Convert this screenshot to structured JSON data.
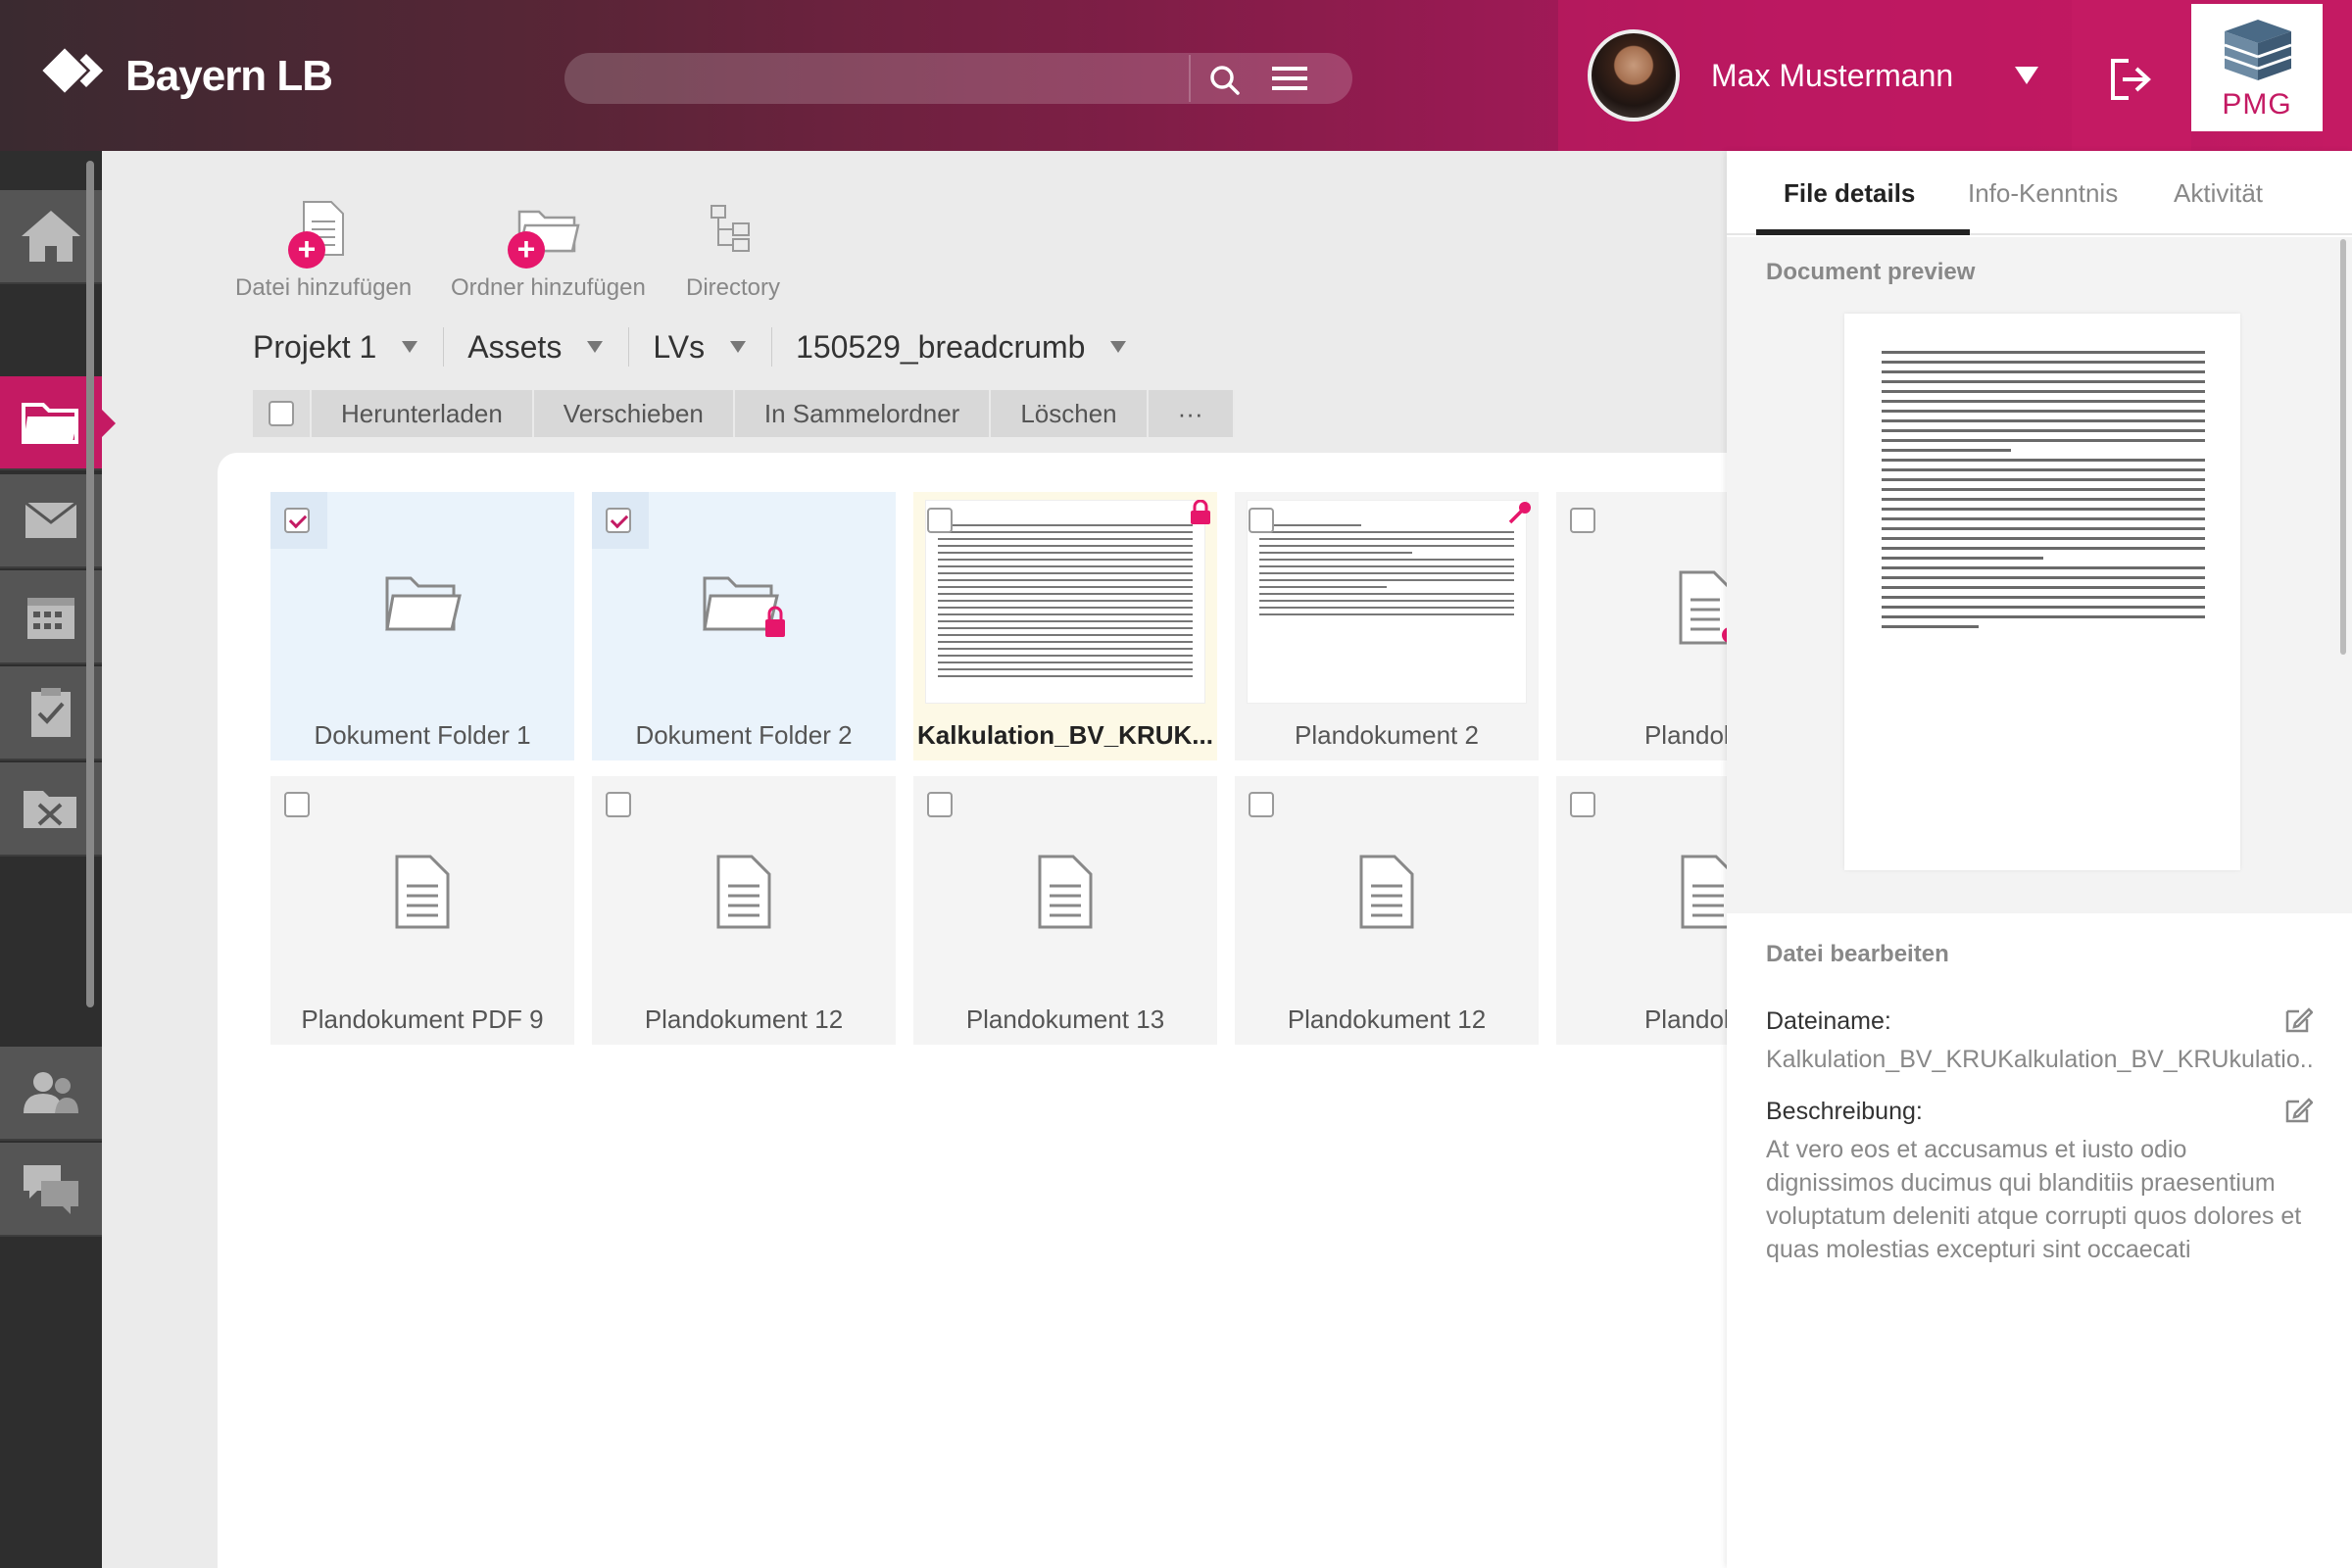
{
  "header": {
    "logo_text": "Bayern LB",
    "search": {
      "placeholder": "",
      "value": ""
    },
    "user_name": "Max Mustermann",
    "brand_text": "PMG"
  },
  "toolbar": {
    "add_file": "Datei hinzufügen",
    "add_folder": "Ordner hinzufügen",
    "directory": "Directory"
  },
  "breadcrumb": [
    {
      "label": "Projekt 1"
    },
    {
      "label": "Assets"
    },
    {
      "label": "LVs"
    },
    {
      "label": "150529_breadcrumb"
    }
  ],
  "actions": {
    "download": "Herunterladen",
    "move": "Verschieben",
    "collect": "In Sammelordner",
    "delete": "Löschen",
    "more": "···"
  },
  "tiles": [
    {
      "label": "Dokument Folder 1",
      "type": "folder",
      "checked": true
    },
    {
      "label": "Dokument Folder 2",
      "type": "folder-locked",
      "checked": true
    },
    {
      "label": "Kalkulation_BV_KRUK...",
      "type": "document-preview",
      "checked": false,
      "status": "locked"
    },
    {
      "label": "Plandokument 2",
      "type": "document-preview",
      "checked": false,
      "status": "key"
    },
    {
      "label": "Plandokum",
      "type": "file-error",
      "checked": false
    },
    {
      "label": "Plandokument PDF 9",
      "type": "file",
      "checked": false
    },
    {
      "label": "Plandokument 12",
      "type": "file",
      "checked": false
    },
    {
      "label": "Plandokument 13",
      "type": "file",
      "checked": false
    },
    {
      "label": "Plandokument 12",
      "type": "file",
      "checked": false
    },
    {
      "label": "Plandokum",
      "type": "file",
      "checked": false
    }
  ],
  "right_panel": {
    "tabs": [
      "File details",
      "Info-Kenntnis",
      "Aktivität"
    ],
    "active_tab": "File details",
    "preview_heading": "Document preview",
    "edit_heading": "Datei bearbeiten",
    "filename_label": "Dateiname:",
    "filename_value": "Kalkulation_BV_KRUKalkulation_BV_KRUkulatio...",
    "description_label": "Beschreibung:",
    "description_value": "At vero eos et accusamus et iusto odio dignissimos ducimus qui blanditiis praesentium voluptatum deleniti atque corrupti quos dolores et quas molestias excepturi sint occaecati"
  },
  "nav": [
    "home-icon",
    "folder-icon",
    "mail-icon",
    "calendar-icon",
    "clipboard-check-icon",
    "folder-tools-icon",
    "users-icon",
    "chat-icon"
  ],
  "colors": {
    "accent": "#c41a63",
    "header_dark": "#3a2a30",
    "nav_bg": "#2e2e2e",
    "nav_item": "#555555"
  }
}
